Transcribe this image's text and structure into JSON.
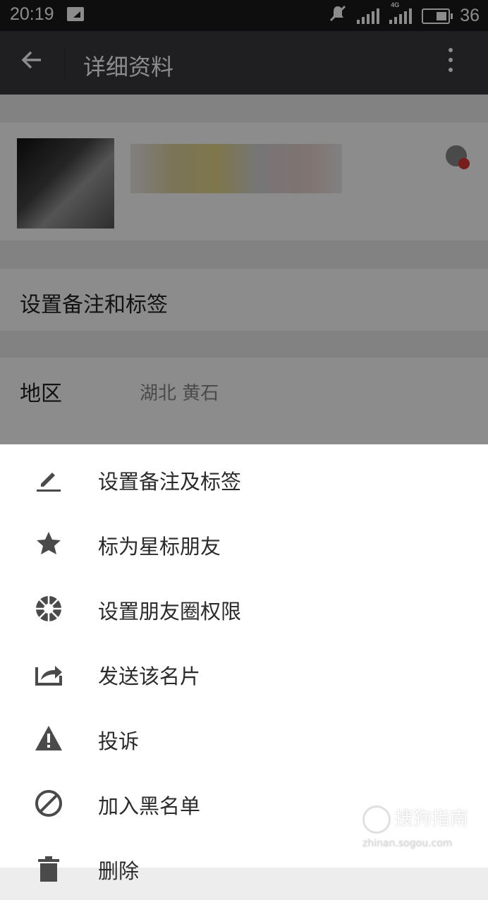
{
  "status_bar": {
    "time": "20:19",
    "network_type": "4G",
    "battery": "36"
  },
  "app_bar": {
    "title": "详细资料"
  },
  "profile": {
    "remark_label": "设置备注和标签",
    "region_label": "地区",
    "region_value": "湖北  黄石"
  },
  "menu": {
    "items": [
      {
        "label": "设置备注及标签",
        "icon": "pencil-icon"
      },
      {
        "label": "标为星标朋友",
        "icon": "star-icon"
      },
      {
        "label": "设置朋友圈权限",
        "icon": "moments-icon"
      },
      {
        "label": "发送该名片",
        "icon": "share-icon"
      },
      {
        "label": "投诉",
        "icon": "warning-icon"
      },
      {
        "label": "加入黑名单",
        "icon": "block-icon"
      },
      {
        "label": "删除",
        "icon": "trash-icon"
      }
    ]
  },
  "watermark": {
    "text": "搜狗指南",
    "sub": "zhinan.sogou.com"
  },
  "colors": {
    "app_bar": "#393a3f",
    "icon": "#4a4a4a"
  }
}
